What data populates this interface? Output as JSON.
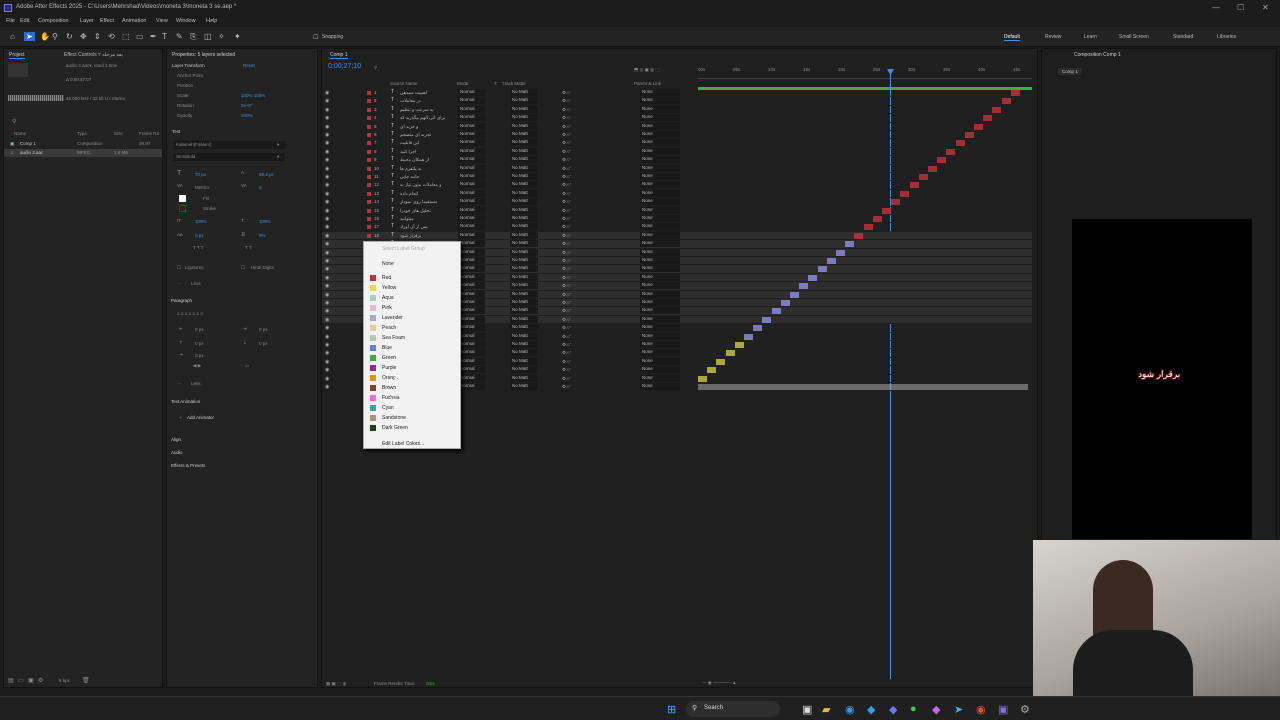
{
  "window": {
    "title": "Adobe After Effects 2025 - C:\\Users\\Mehrshad\\Videos\\moneta 3\\moneta 3 se.aep *"
  },
  "menu": [
    "File",
    "Edit",
    "Composition",
    "Layer",
    "Effect",
    "Animation",
    "View",
    "Window",
    "Help"
  ],
  "toolbar": {
    "snapping": "Snapping"
  },
  "workspaces": [
    "Default",
    "Review",
    "Learn",
    "Small Screen",
    "Standard",
    "Libraries"
  ],
  "project": {
    "tab": "Project",
    "effect_controls_tab": "Effect Controls بعد مرحله ۲",
    "file_name": "audio 3.aac▾, used 1 time",
    "file_duration": "Δ 0:00:47:07",
    "file_audio": "48.000 kHz / 32 bit U / Stereo",
    "columns": [
      "Name",
      "Type",
      "Size",
      "Frame Ra"
    ],
    "items": [
      {
        "name": "Comp 1",
        "type": "Composition",
        "size": "",
        "fps": "29.97"
      },
      {
        "name": "audio 3.aac",
        "type": "MPEG",
        "size": "1.8 MB",
        "fps": ""
      }
    ],
    "bpc": "8 bpc"
  },
  "properties": {
    "title": "Properties: 5 layers selected",
    "layer_transform": "Layer Transform",
    "reset": "Reset",
    "transform": [
      {
        "label": "Anchor Point",
        "value": ""
      },
      {
        "label": "Position",
        "value": ""
      },
      {
        "label": "Scale",
        "value": "100%  100%"
      },
      {
        "label": "Rotation",
        "value": "0x+0°"
      },
      {
        "label": "Opacity",
        "value": "100%"
      }
    ],
    "text": "Text",
    "font": "Kalameh(FaNum)",
    "style": "SemiBold",
    "font_size": "70 px",
    "leading": "88.4 px",
    "kerning": "Metrics",
    "tracking": "0",
    "fill": "Fill",
    "stroke": "Stroke",
    "vscale": "100%",
    "hscale": "100%",
    "baseline": "0 px",
    "tsume": "0%",
    "ligatures": "Ligatures",
    "hindi": "Hindi Digits",
    "less": "Less",
    "paragraph": "Paragraph",
    "para_values": [
      "0 px",
      "0 px",
      "0 px",
      "0 px",
      "0 px"
    ],
    "text_animation": "Text Animation",
    "add_animator": "Add Animator",
    "align": "Align",
    "audio": "Audio",
    "effects_presets": "Effects & Presets"
  },
  "timeline": {
    "tab": "Comp 1",
    "timecode": "0;00;27;10",
    "col_source": "Source Name",
    "col_mode": "Mode",
    "col_t": "T",
    "col_trackmatte": "Track Matte",
    "col_parent": "Parent & Link",
    "ruler": [
      "00s",
      "05s",
      "10s",
      "15s",
      "20s",
      "25s",
      "30s",
      "35s",
      "40s",
      "45s"
    ],
    "frame_render": "Frame Render Time:",
    "frame_render_val": "0ms",
    "layers": [
      {
        "n": "1",
        "name": "اهمیت سیدهی",
        "mode": "Normal",
        "matte": "No Matt",
        "parent": "None",
        "color": "#b8343b"
      },
      {
        "n": "2",
        "name": "در معاملات",
        "mode": "Normal",
        "matte": "No Matt",
        "parent": "None",
        "color": "#b8343b"
      },
      {
        "n": "3",
        "name": "به سرعت و تنظیم",
        "mode": "Normal",
        "matte": "No Matt",
        "parent": "None",
        "color": "#b8343b"
      },
      {
        "n": "4",
        "name": "برای اتی الهم بیگذرید که",
        "mode": "Normal",
        "matte": "No Matt",
        "parent": "None",
        "color": "#b8343b"
      },
      {
        "n": "5",
        "name": "و خرید ای",
        "mode": "Normal",
        "matte": "No Matt",
        "parent": "None",
        "color": "#b8343b"
      },
      {
        "n": "6",
        "name": "تجربه ای متصحم",
        "mode": "Normal",
        "matte": "No Matt",
        "parent": "None",
        "color": "#b8343b"
      },
      {
        "n": "7",
        "name": "این قابلیت",
        "mode": "Normal",
        "matte": "No Matt",
        "parent": "None",
        "color": "#b8343b"
      },
      {
        "n": "8",
        "name": "اجرا کنید",
        "mode": "Normal",
        "matte": "No Matt",
        "parent": "None",
        "color": "#b8343b"
      },
      {
        "n": "9",
        "name": "از همکان محیط",
        "mode": "Normal",
        "matte": "No Matt",
        "parent": "None",
        "color": "#b8343b"
      },
      {
        "n": "10",
        "name": "به پلتفرم ها",
        "mode": "Normal",
        "matte": "No Matt",
        "parent": "None",
        "color": "#b8343b"
      },
      {
        "n": "11",
        "name": "جامه جایی",
        "mode": "Normal",
        "matte": "No Matt",
        "parent": "None",
        "color": "#b8343b"
      },
      {
        "n": "12",
        "name": "و معاملات بدون نیاز به",
        "mode": "Normal",
        "matte": "No Matt",
        "parent": "None",
        "color": "#b8343b"
      },
      {
        "n": "13",
        "name": "انجام داده",
        "mode": "Normal",
        "matte": "No Matt",
        "parent": "None",
        "color": "#b8343b"
      },
      {
        "n": "14",
        "name": "مستقیما روی نمودار",
        "mode": "Normal",
        "matte": "No Matt",
        "parent": "None",
        "color": "#b8343b"
      },
      {
        "n": "15",
        "name": "تحلیل های خودرا",
        "mode": "Normal",
        "matte": "No Matt",
        "parent": "None",
        "color": "#b8343b"
      },
      {
        "n": "16",
        "name": "میتوانید",
        "mode": "Normal",
        "matte": "No Matt",
        "parent": "None",
        "color": "#b8343b"
      },
      {
        "n": "17",
        "name": "پس از آن اوراد",
        "mode": "Normal",
        "matte": "No Matt",
        "parent": "None",
        "color": "#b8343b"
      },
      {
        "n": "18",
        "name": "برقرار شود",
        "mode": "Normal",
        "matte": "No Matt",
        "parent": "None",
        "color": "#b8343b"
      },
      {
        "n": "19",
        "name": "",
        "mode": "Normal",
        "matte": "No Matt",
        "parent": "None",
        "color": "#8a8ad8"
      },
      {
        "n": "20",
        "name": "",
        "mode": "Normal",
        "matte": "No Matt",
        "parent": "None",
        "color": "#8a8ad8"
      },
      {
        "n": "21",
        "name": "",
        "mode": "Normal",
        "matte": "No Matt",
        "parent": "None",
        "color": "#8a8ad8"
      },
      {
        "n": "22",
        "name": "",
        "mode": "Normal",
        "matte": "No Matt",
        "parent": "None",
        "color": "#8a8ad8"
      },
      {
        "n": "23",
        "name": "",
        "mode": "Normal",
        "matte": "No Matt",
        "parent": "None",
        "color": "#8a8ad8"
      },
      {
        "n": "24",
        "name": "",
        "mode": "Normal",
        "matte": "No Matt",
        "parent": "None",
        "color": "#8a8ad8"
      },
      {
        "n": "25",
        "name": "",
        "mode": "Normal",
        "matte": "No Matt",
        "parent": "None",
        "color": "#8a8ad8"
      },
      {
        "n": "26",
        "name": "",
        "mode": "Normal",
        "matte": "No Matt",
        "parent": "None",
        "color": "#8a8ad8"
      },
      {
        "n": "27",
        "name": "",
        "mode": "Normal",
        "matte": "No Matt",
        "parent": "None",
        "color": "#8a8ad8"
      },
      {
        "n": "28",
        "name": "",
        "mode": "Normal",
        "matte": "No Matt",
        "parent": "None",
        "color": "#8a8ad8"
      },
      {
        "n": "29",
        "name": "",
        "mode": "Normal",
        "matte": "No Matt",
        "parent": "None",
        "color": "#8a8ad8"
      },
      {
        "n": "30",
        "name": "",
        "mode": "Normal",
        "matte": "No Matt",
        "parent": "None",
        "color": "#8a8ad8"
      },
      {
        "n": "31",
        "name": "",
        "mode": "Normal",
        "matte": "No Matt",
        "parent": "None",
        "color": "#c8c040"
      },
      {
        "n": "32",
        "name": "",
        "mode": "Normal",
        "matte": "No Matt",
        "parent": "None",
        "color": "#c8c040"
      },
      {
        "n": "33",
        "name": "",
        "mode": "Normal",
        "matte": "No Matt",
        "parent": "None",
        "color": "#c8c040"
      },
      {
        "n": "34",
        "name": "",
        "mode": "Normal",
        "matte": "No Matt",
        "parent": "None",
        "color": "#c8c040"
      },
      {
        "n": "35",
        "name": "",
        "mode": "Normal",
        "matte": "No Matt",
        "parent": "None",
        "color": "#c8c040"
      },
      {
        "n": "36",
        "name": "",
        "mode": "Normal",
        "matte": "No Matt",
        "parent": "None",
        "color": "#aaaaaa"
      }
    ]
  },
  "label_menu": {
    "header": "Select Label Group",
    "none": "None",
    "items": [
      {
        "name": "Red",
        "color": "#b8343b"
      },
      {
        "name": "Yellow",
        "color": "#e4d84c"
      },
      {
        "name": "Aqua",
        "color": "#a9cbc7"
      },
      {
        "name": "Pink",
        "color": "#e5bcc9"
      },
      {
        "name": "Lavender",
        "color": "#a9a9ca"
      },
      {
        "name": "Peach",
        "color": "#e5c8a6"
      },
      {
        "name": "Sea Foam",
        "color": "#b4c7b4"
      },
      {
        "name": "Blue",
        "color": "#677de0"
      },
      {
        "name": "Green",
        "color": "#4aa44c"
      },
      {
        "name": "Purple",
        "color": "#8e2c9a"
      },
      {
        "name": "Orange",
        "color": "#e8920d"
      },
      {
        "name": "Brown",
        "color": "#7f452a"
      },
      {
        "name": "Fuchsia",
        "color": "#f46dd6"
      },
      {
        "name": "Cyan",
        "color": "#3da2a5"
      },
      {
        "name": "Sandstone",
        "color": "#a89677"
      },
      {
        "name": "Dark Green",
        "color": "#1e401e"
      }
    ],
    "edit": "Edit Label Colors..."
  },
  "composition": {
    "tab": "Composition Comp 1",
    "sub": "Comp 1",
    "preview_text": "برقرار شود"
  },
  "taskbar": {
    "search": "Search"
  }
}
